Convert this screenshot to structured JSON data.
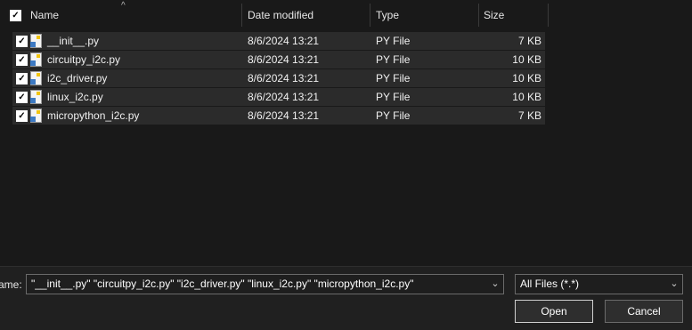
{
  "header": {
    "select_all_checked": true,
    "columns": {
      "name": "Name",
      "date": "Date modified",
      "type": "Type",
      "size": "Size"
    },
    "sort_indicator": "^"
  },
  "files": [
    {
      "name": "__init__.py",
      "date": "8/6/2024 13:21",
      "type": "PY File",
      "size": "7 KB",
      "checked": true
    },
    {
      "name": "circuitpy_i2c.py",
      "date": "8/6/2024 13:21",
      "type": "PY File",
      "size": "10 KB",
      "checked": true
    },
    {
      "name": "i2c_driver.py",
      "date": "8/6/2024 13:21",
      "type": "PY File",
      "size": "10 KB",
      "checked": true
    },
    {
      "name": "linux_i2c.py",
      "date": "8/6/2024 13:21",
      "type": "PY File",
      "size": "10 KB",
      "checked": true
    },
    {
      "name": "micropython_i2c.py",
      "date": "8/6/2024 13:21",
      "type": "PY File",
      "size": "7 KB",
      "checked": true
    }
  ],
  "file_icon": "python-file-icon",
  "footer": {
    "filename_label": "ame:",
    "filename_value": "\"__init__.py\" \"circuitpy_i2c.py\" \"i2c_driver.py\" \"linux_i2c.py\" \"micropython_i2c.py\"",
    "filter_value": "All Files (*.*)",
    "open_label": "Open",
    "cancel_label": "Cancel"
  },
  "colors": {
    "background": "#191919",
    "row": "#2b2b2b",
    "footer": "#202020",
    "text": "#ffffff"
  }
}
